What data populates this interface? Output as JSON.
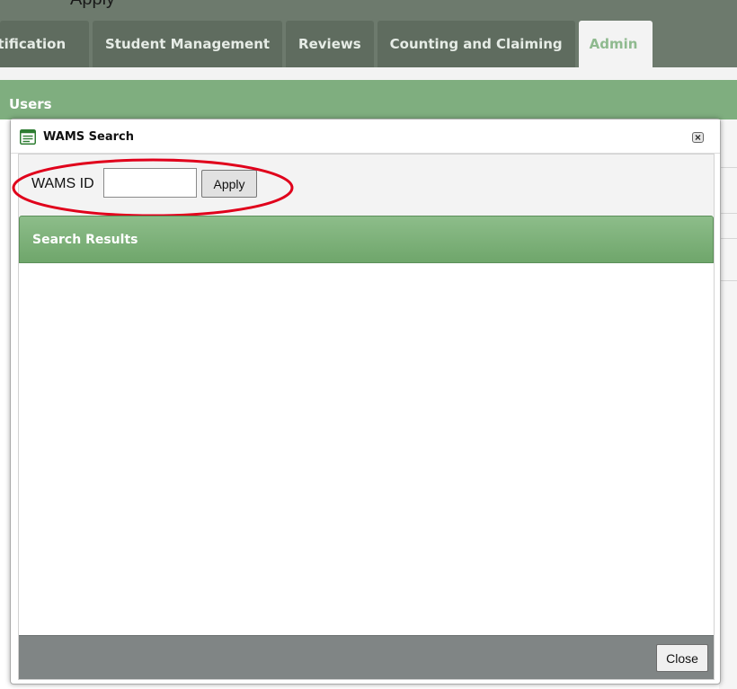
{
  "app": {
    "top_partial_text": "Apply",
    "tabs": [
      {
        "label": "rtification"
      },
      {
        "label": "Student Management"
      },
      {
        "label": "Reviews"
      },
      {
        "label": "Counting and Claiming"
      },
      {
        "label": "Admin",
        "active": true
      }
    ],
    "section_title": "Users"
  },
  "modal": {
    "title": "WAMS Search",
    "icon": "list-document-icon",
    "close_icon": "close-x-icon",
    "search": {
      "label": "WAMS ID",
      "value": "",
      "apply_label": "Apply"
    },
    "results": {
      "title": "Search Results"
    },
    "footer": {
      "close_label": "Close"
    }
  },
  "colors": {
    "nav_bg": "#6d7a6d",
    "tab_bg": "#5f6c5f",
    "active_tab_text": "#8fba8f",
    "section_header_bg": "#7fae7f",
    "results_header_bg": "#7fb17c",
    "footer_bg": "#808585",
    "highlight_ring": "#e0001b"
  }
}
